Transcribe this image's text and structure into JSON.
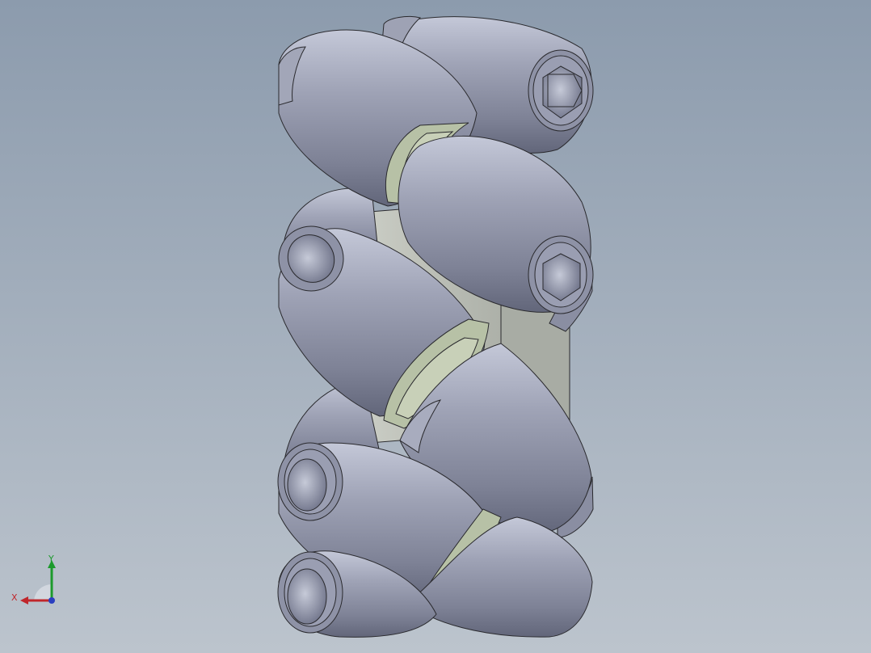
{
  "viewport": {
    "background_top": "#8c9bad",
    "background_bottom": "#bcc4cd",
    "model": {
      "roller_color": "#8e92a6",
      "roller_highlight": "#c4c8d8",
      "roller_shadow": "#62667a",
      "hub_plate_color": "#b4b8b0",
      "ring_color": "#b7c1a6",
      "edge_color": "#2a2a2e"
    }
  },
  "triad": {
    "x_label": "X",
    "y_label": "Y",
    "x_color": "#c0262b",
    "y_color": "#1c9a2c",
    "z_color": "#2a3fc0"
  }
}
